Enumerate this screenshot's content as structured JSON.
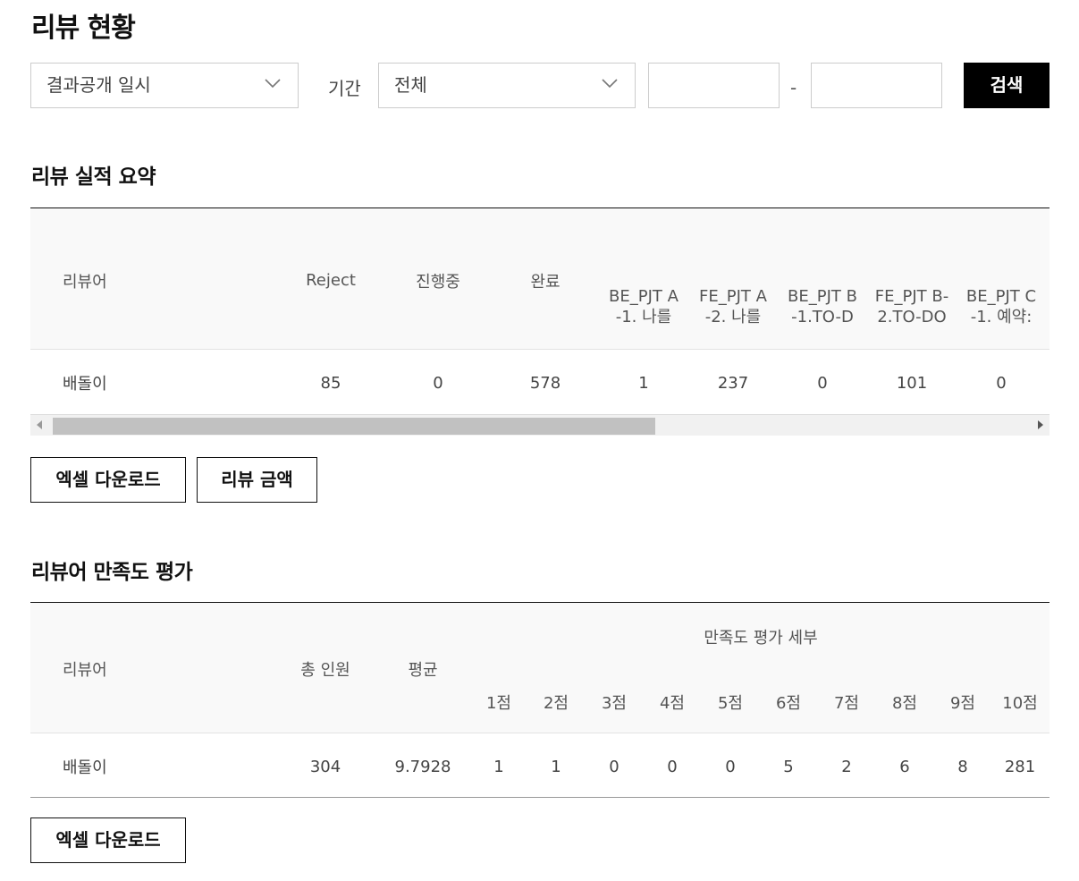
{
  "page": {
    "title": "리뷰 현황"
  },
  "filters": {
    "date_type": {
      "value": "결과공개 일시"
    },
    "period_label": "기간",
    "period": {
      "value": "전체"
    },
    "start_date": {
      "value": ""
    },
    "end_date": {
      "value": ""
    },
    "range_separator": "-",
    "search_label": "검색"
  },
  "summary": {
    "title": "리뷰 실적 요약",
    "headers": {
      "reviewer": "리뷰어",
      "reject": "Reject",
      "in_progress": "진행중",
      "done": "완료",
      "projects": [
        {
          "line1": "BE_PJT A",
          "line2": "-1. 나를"
        },
        {
          "line1": "FE_PJT A",
          "line2": "-2. 나를"
        },
        {
          "line1": "BE_PJT B",
          "line2": "-1.TO-D"
        },
        {
          "line1": "FE_PJT B-",
          "line2": "2.TO-DO"
        },
        {
          "line1": "BE_PJT C",
          "line2": "-1. 예약:"
        }
      ]
    },
    "rows": [
      {
        "reviewer": "배돌이",
        "reject": "85",
        "in_progress": "0",
        "done": "578",
        "projects": [
          "1",
          "237",
          "0",
          "101",
          "0"
        ]
      }
    ],
    "excel_label": "엑셀 다운로드",
    "amount_label": "리뷰 금액"
  },
  "satisfaction": {
    "title": "리뷰어 만족도 평가",
    "headers": {
      "reviewer": "리뷰어",
      "total": "총 인원",
      "average": "평균",
      "detail": "만족도 평가 세부",
      "scores": [
        "1점",
        "2점",
        "3점",
        "4점",
        "5점",
        "6점",
        "7점",
        "8점",
        "9점",
        "10점"
      ]
    },
    "rows": [
      {
        "reviewer": "배돌이",
        "total": "304",
        "average": "9.7928",
        "scores": [
          "1",
          "1",
          "0",
          "0",
          "0",
          "5",
          "2",
          "6",
          "8",
          "281"
        ]
      }
    ],
    "excel_label": "엑셀 다운로드"
  },
  "icons": {
    "dropdown": "chevron-down-icon",
    "scroll_left": "arrow-left-icon",
    "scroll_right": "arrow-right-icon"
  },
  "colors": {
    "primary_button": "#000000",
    "header_bg": "#f9f9f9",
    "border": "#cccccc",
    "scroll_thumb": "#c1c1c1"
  }
}
